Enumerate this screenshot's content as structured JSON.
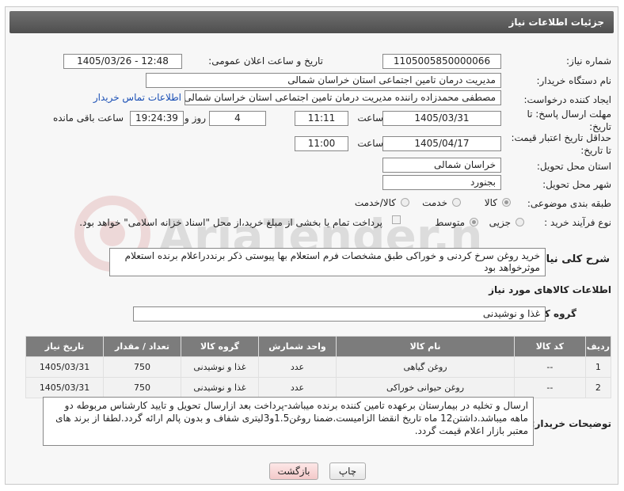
{
  "header": {
    "title": "جزئیات اطلاعات نیاز"
  },
  "fields": {
    "need_number_label": "شماره نیاز:",
    "need_number": "1105005850000066",
    "announce_label": "تاریخ و ساعت اعلان عمومی:",
    "announce_value": "1405/03/26 - 12:48",
    "buyer_org_label": "نام دستگاه خریدار:",
    "buyer_org": "مدیریت درمان تامین اجتماعی استان خراسان شمالی",
    "creator_label": "ایجاد کننده درخواست:",
    "creator": "مصطفی محمدزاده راننده مدیریت درمان تامین اجتماعی استان خراسان شمالی",
    "contact_link": "اطلاعات تماس خریدار",
    "reply_deadline_label": "مهلت ارسال پاسخ: تا تاریخ:",
    "reply_date": "1405/03/31",
    "time_label": "ساعت",
    "reply_time": "11:11",
    "days_value": "4",
    "days_label": "روز و",
    "remaining_time": "19:24:39",
    "remaining_label": "ساعت باقی مانده",
    "price_validity_label": "حداقل تاریخ اعتبار قیمت: تا تاریخ:",
    "price_date": "1405/04/17",
    "price_time": "11:00",
    "province_label": "استان محل تحویل:",
    "province": "خراسان شمالی",
    "city_label": "شهر محل تحویل:",
    "city": "بجنورد",
    "category_label": "طبقه بندی موضوعی:",
    "category_options": [
      "کالا",
      "خدمت",
      "کالا/خدمت"
    ],
    "category_selected": "کالا",
    "process_label": "نوع فرآیند خرید :",
    "process_options": [
      "جزیی",
      "متوسط"
    ],
    "process_selected": "متوسط",
    "payment_note": "پرداخت تمام یا بخشی از مبلغ خرید،از محل \"اسناد خزانه اسلامی\" خواهد بود.",
    "description_label": "شرح کلی نیاز:",
    "description": "خرید روغن سرخ کردنی و خوراکی طبق مشخصات فرم استعلام بها پیوستی ذکر برنددراعلام برنده استعلام موثرخواهد بود",
    "goods_info_heading": "اطلاعات کالاهای مورد نیاز",
    "goods_group_label": "گروه کالا:",
    "goods_group": "غذا و نوشیدنی",
    "buyer_notes_label": "توضیحات خریدار:",
    "buyer_notes": "ارسال و تخلیه در بیمارستان برعهده تامین کننده برنده میباشد-پرداخت بعد ازارسال تحویل و تایید کارشناس مربوطه دو ماهه میباشد.داشتن12 ماه تاریخ انقضا الزامیست.ضمنا روغن1.5و3لیتری شفاف و بدون پالم ارائه گردد.لطفا از برند های معتبر بازار اعلام قیمت گردد."
  },
  "table": {
    "headers": [
      "ردیف",
      "کد کالا",
      "نام کالا",
      "واحد شمارش",
      "گروه کالا",
      "تعداد / مقدار",
      "تاریخ نیاز"
    ],
    "rows": [
      [
        "1",
        "--",
        "روغن گیاهی",
        "عدد",
        "غذا و نوشیدنی",
        "750",
        "1405/03/31"
      ],
      [
        "2",
        "--",
        "روغن حیوانی خوراکی",
        "عدد",
        "غذا و نوشیدنی",
        "750",
        "1405/03/31"
      ]
    ]
  },
  "buttons": {
    "print": "چاپ",
    "back": "بازگشت"
  },
  "watermark_text": "AriaTender.neT",
  "colors": {
    "titlebar": "#5f5f5f",
    "table_header": "#7c7c7c",
    "link": "#1a4fb5"
  }
}
